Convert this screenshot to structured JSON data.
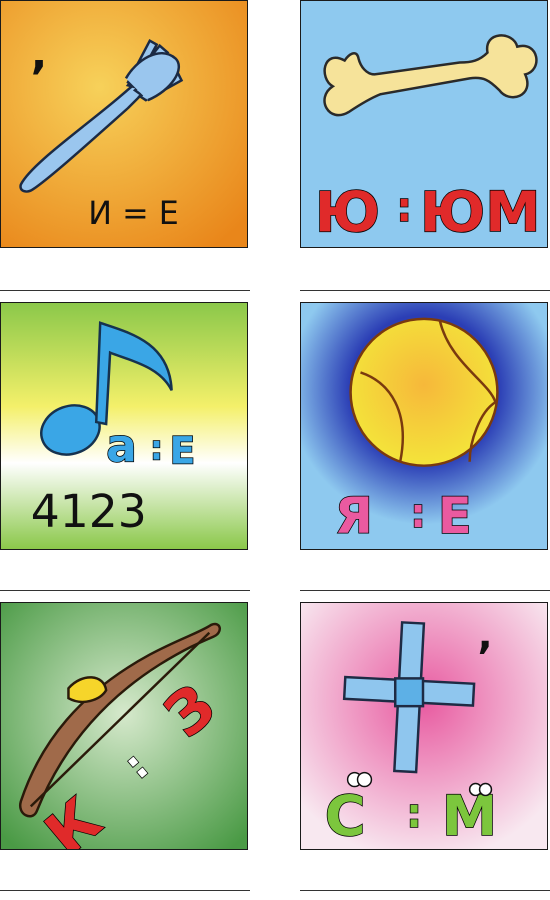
{
  "puzzles": [
    {
      "id": "fork",
      "comma": ",",
      "rule": "И = Е",
      "bg": [
        "#f2b23b",
        "#e8881c"
      ]
    },
    {
      "id": "bone",
      "rule_left": "Ю",
      "rule_sep": ":",
      "rule_right": "ЮМ",
      "bg": [
        "#8ec9ef",
        "#8ec9ef"
      ]
    },
    {
      "id": "note",
      "rule_left": "а",
      "rule_sep": ":",
      "rule_right": "Е",
      "digits": "4123",
      "bg": [
        "#8cc84a",
        "#f2f068"
      ]
    },
    {
      "id": "ball",
      "rule_left": "Я",
      "rule_sep": ":",
      "rule_right": "Е",
      "bg": [
        "#8ec9ef",
        "#2f3fb0"
      ]
    },
    {
      "id": "bow",
      "rule_left": "К",
      "rule_sep": ":",
      "rule_right": "З",
      "bg": [
        "#4e9a45",
        "#cfe6c4"
      ]
    },
    {
      "id": "cross",
      "comma": ",",
      "rule_left": "С",
      "rule_sep": ":",
      "rule_right": "М",
      "bg": [
        "#e85aa0",
        "#f7e6ef"
      ]
    }
  ],
  "colors": {
    "red_letter": "#e02a2a",
    "blue_letter": "#35a7e6",
    "green_letter": "#7cc63d",
    "pink_letter": "#ea5aa0"
  }
}
